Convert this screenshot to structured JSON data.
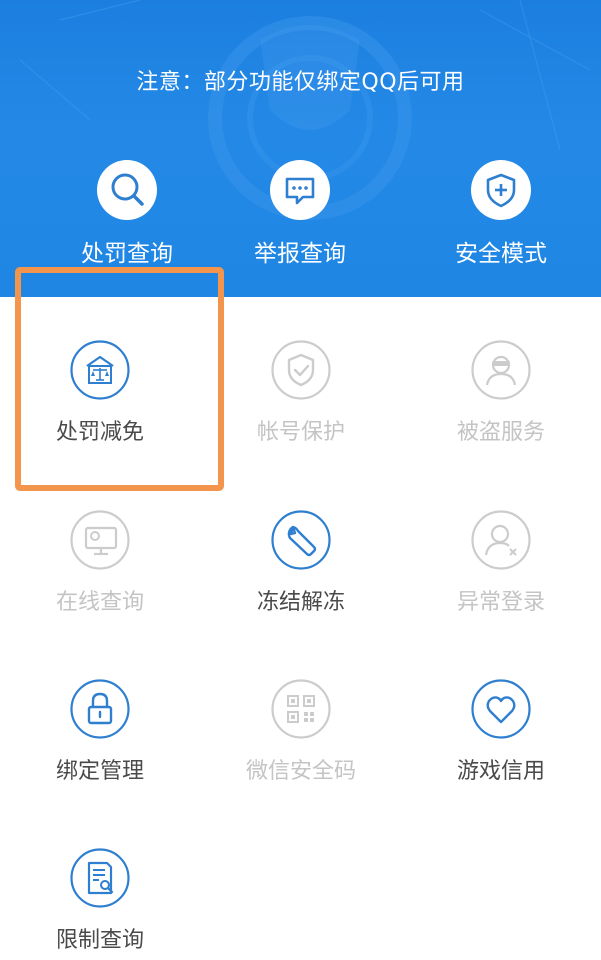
{
  "header": {
    "notice": "注意：部分功能仅绑定QQ后可用",
    "quick_links": [
      {
        "label": "处罚查询",
        "icon": "search-icon"
      },
      {
        "label": "举报查询",
        "icon": "report-chat-icon"
      },
      {
        "label": "安全模式",
        "icon": "shield-plus-icon"
      }
    ]
  },
  "grid": {
    "items": [
      {
        "label": "处罚减免",
        "icon": "scale-house-icon",
        "enabled": true,
        "highlighted": true
      },
      {
        "label": "帐号保护",
        "icon": "shield-check-icon",
        "enabled": false
      },
      {
        "label": "被盗服务",
        "icon": "thief-person-icon",
        "enabled": false
      },
      {
        "label": "在线查询",
        "icon": "monitor-person-icon",
        "enabled": false
      },
      {
        "label": "冻结解冻",
        "icon": "wrench-icon",
        "enabled": true
      },
      {
        "label": "异常登录",
        "icon": "person-x-icon",
        "enabled": false
      },
      {
        "label": "绑定管理",
        "icon": "lock-icon",
        "enabled": true
      },
      {
        "label": "微信安全码",
        "icon": "qr-code-icon",
        "enabled": false
      },
      {
        "label": "游戏信用",
        "icon": "heart-icon",
        "enabled": true
      },
      {
        "label": "限制查询",
        "icon": "document-search-icon",
        "enabled": true
      }
    ]
  },
  "colors": {
    "banner_blue": "#1f86e4",
    "icon_active": "#2f7fd0",
    "icon_disabled": "#cccccc",
    "highlight": "#f3954d"
  }
}
